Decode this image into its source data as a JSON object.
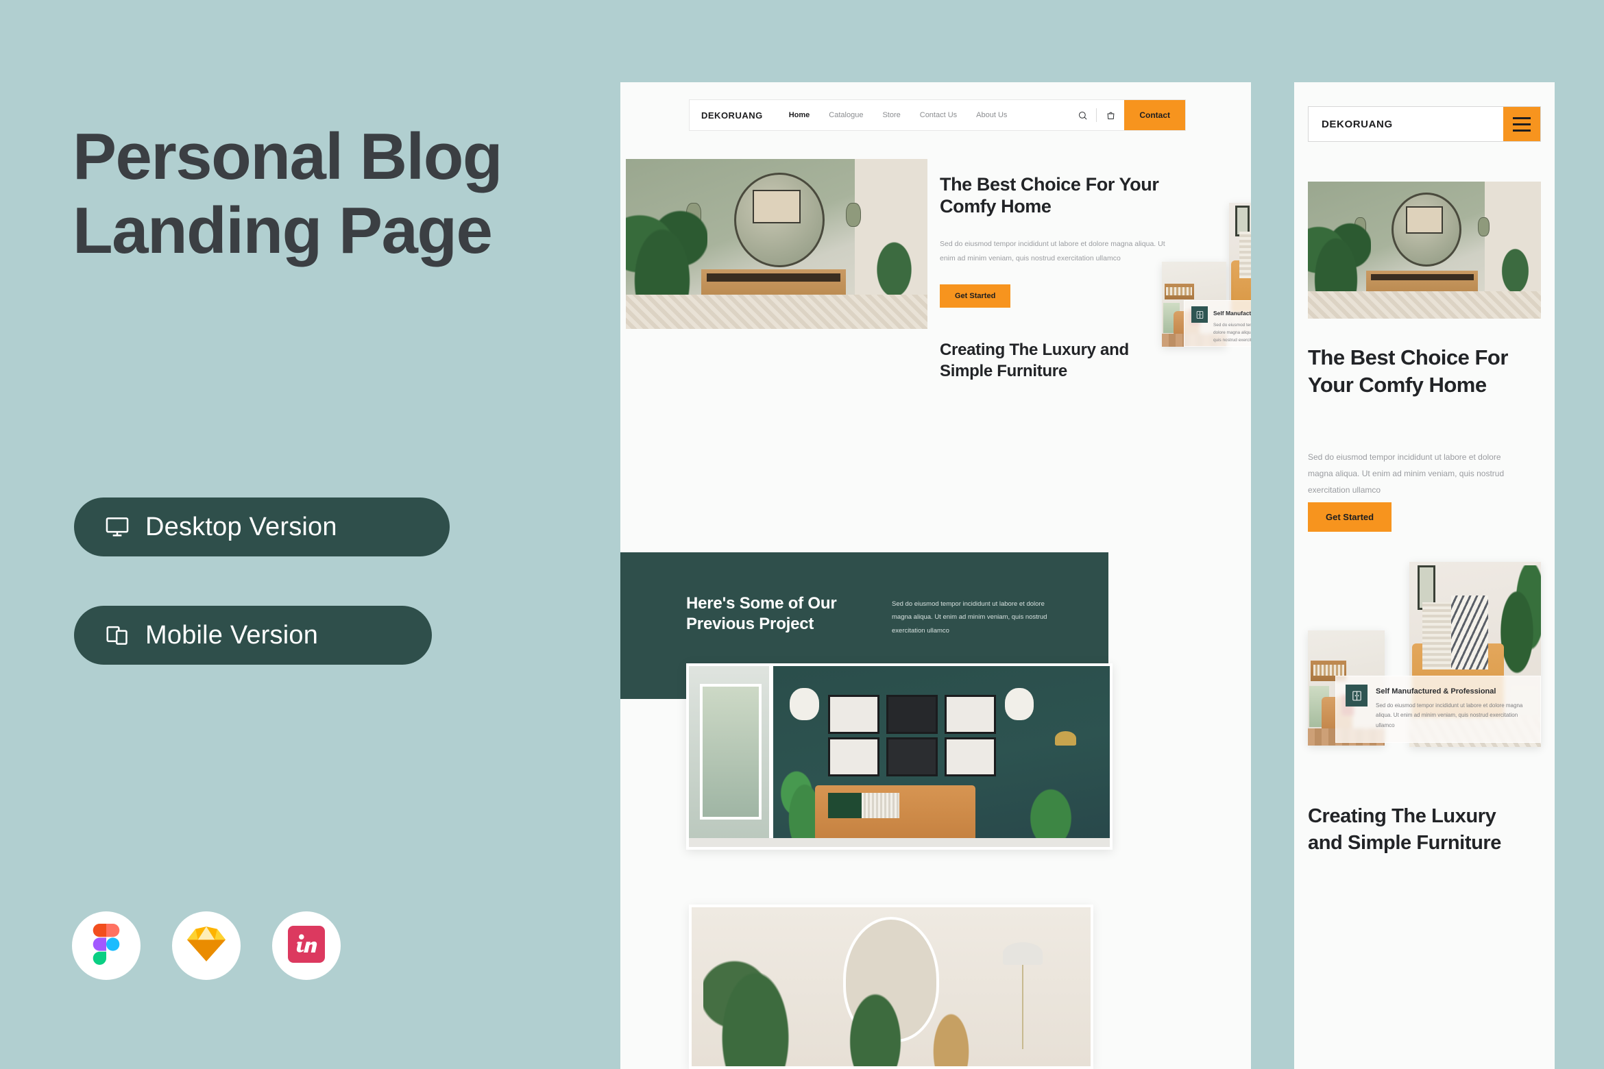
{
  "theme": {
    "background": "#b1cfd0",
    "accent_orange": "#f7941e",
    "dark_green": "#2f4f4b",
    "text_dark": "#3b3f43"
  },
  "left": {
    "title_line1": "Personal Blog",
    "title_line2": "Landing Page",
    "buttons": [
      {
        "label": "Desktop Version",
        "icon": "monitor-icon"
      },
      {
        "label": "Mobile Version",
        "icon": "devices-icon"
      }
    ],
    "app_icons": [
      {
        "name": "figma-icon"
      },
      {
        "name": "sketch-icon"
      },
      {
        "name": "invision-icon"
      }
    ]
  },
  "desktop": {
    "nav": {
      "logo": "DEKORUANG",
      "links": [
        {
          "label": "Home",
          "active": true
        },
        {
          "label": "Catalogue",
          "active": false
        },
        {
          "label": "Store",
          "active": false
        },
        {
          "label": "Contact Us",
          "active": false
        },
        {
          "label": "About Us",
          "active": false
        }
      ],
      "search_icon": "search-icon",
      "bag_icon": "shopping-bag-icon",
      "contact_label": "Contact"
    },
    "hero": {
      "heading": "The Best Choice For Your Comfy Home",
      "paragraph": "Sed do eiusmod tempor incididunt ut labore et dolore magna aliqua. Ut enim ad minim veniam, quis nostrud exercitation ullamco",
      "cta_label": "Get Started"
    },
    "subheading": "Creating The Luxury and Simple Furniture",
    "feature_card": {
      "badge_icon": "cabinet-icon",
      "title": "Self Manufactured & Professional",
      "body": "Sed do eiusmod tempor incididunt ut labore et dolore magna aliqua. Ut enim ad minim veniam, quis nostrud exercitation ullamco"
    },
    "projects": {
      "heading": "Here's Some of Our Previous Project",
      "paragraph": "Sed do eiusmod tempor incididunt ut labore et dolore magna aliqua. Ut enim ad minim veniam, quis nostrud exercitation ullamco"
    }
  },
  "mobile": {
    "nav": {
      "logo": "DEKORUANG",
      "menu_icon": "hamburger-menu-icon"
    },
    "hero": {
      "heading": "The Best Choice For Your Comfy Home",
      "paragraph": "Sed do eiusmod tempor incididunt ut labore et dolore magna aliqua. Ut enim ad minim veniam, quis nostrud exercitation ullamco",
      "cta_label": "Get Started"
    },
    "feature_card": {
      "badge_icon": "cabinet-icon",
      "title": "Self Manufactured & Professional",
      "body": "Sed do eiusmod tempor incididunt ut labore et dolore magna aliqua. Ut enim ad minim veniam, quis nostrud exercitation ullamco"
    },
    "subheading": "Creating The Luxury and Simple Furniture"
  }
}
